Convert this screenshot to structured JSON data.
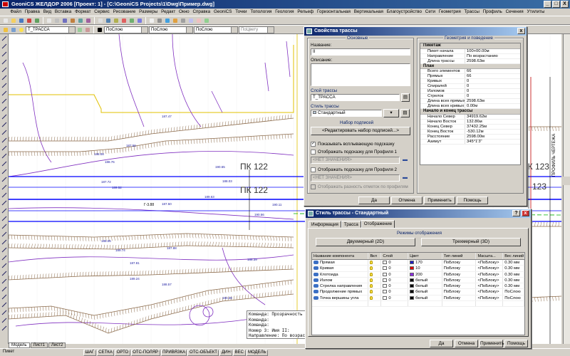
{
  "window": {
    "title": "GeoniCS ЖЕЛДОР 2006 [Проект: 1] - [C:\\GeoniCS Projects\\1\\Dwg\\Пример.dwg]",
    "buttons": [
      "_",
      "□",
      "X"
    ]
  },
  "menu": [
    "Файл",
    "Правка",
    "Вид",
    "Вставка",
    "Формат",
    "Сервис",
    "Рисование",
    "Размеры",
    "Редакт",
    "Окно",
    "Справка",
    "GeoniCS",
    "Точки",
    "Топология",
    "Геология",
    "Рельеф",
    "Горизонтальная",
    "Вертикальная",
    "Благоустройство",
    "Сети",
    "Геометрия",
    "Трассы",
    "Профиль",
    "Сечения",
    "Утилиты"
  ],
  "toolbar": {
    "layer_combo": "Т_ТРАССА",
    "color_combo": "ПоСлою",
    "linetype_combo": "ПоСлою",
    "lineweight_combo": "ПоСлою",
    "plotstyle_combo": "ПоЦвету"
  },
  "canvas": {
    "pk_labels": [
      "ПК 122",
      "ПК 122",
      "ПК 123",
      "123"
    ],
    "side_label": "ПРОФИЛЬ ЧЕРТЕЖА",
    "grade_label": "Г-3.88",
    "elevations": [
      "187.56",
      "188.08",
      "188.76",
      "190.65",
      "187.72",
      "189.52",
      "188.03",
      "189.63",
      "187.50",
      "188.06",
      "189.74",
      "187.81",
      "189.24",
      "188.57",
      "190.38",
      "187.88",
      "188.39",
      "190.56",
      "190.11",
      "187.47"
    ]
  },
  "command_line": [
    "Команда: Прозрачность объекта",
    "Команда:",
    "Команда:",
    "Номер 3: Имя II:",
    "Направление: По возрастанию"
  ],
  "model_tabs": [
    "Модель",
    "Лист1",
    "Лист2"
  ],
  "status": {
    "coords": "Пикет",
    "toggles": [
      "ШАГ",
      "СЕТКА",
      "ОРТО",
      "ОТС-ПОЛЯР",
      "ПРИВЯЗКА",
      "ОТС-ОБЪЕКТ",
      "ДИН",
      "ВЕС",
      "МОДЕЛЬ"
    ]
  },
  "props_dialog": {
    "title": "Свойства трассы",
    "left_group": "Основные",
    "name_label": "Название:",
    "name_value": "II",
    "desc_label": "Описание:",
    "layer_group": "Слой трассы",
    "layer_value": "Т_ТРАССА",
    "style_group": "Стиль трассы",
    "style_value": "Стандартный",
    "labels_group": "Набор подписей",
    "labels_button": "<Редактировать набор подписей...>",
    "chk_popup": "Показывать всплывающую подсказку",
    "chk_profile1": "Отображать подсказку для Профиля 1",
    "no_value_1": "<НЕТ ЗНАЧЕНИЯ>",
    "chk_profile2": "Отображать подсказку для Профиля 2",
    "no_value_2": "<НЕТ ЗНАЧЕНИЯ>",
    "chk_diff": "Отображать разность отметок по профилям",
    "right_group": "Геометрия и поведение",
    "sections": [
      {
        "title": "Пикетаж",
        "rows": [
          [
            "Пикет начала",
            "100+00.00м"
          ],
          [
            "Направление",
            "По возрастанию"
          ],
          [
            "Длина трассы",
            "2598.63м"
          ]
        ]
      },
      {
        "title": "План",
        "rows": [
          [
            "Всего элементов",
            "66"
          ],
          [
            "Прямых",
            "66"
          ],
          [
            "Кривых",
            "0"
          ],
          [
            "Спиралей",
            "0"
          ],
          [
            "Изломов",
            "0"
          ],
          [
            "Стрелок",
            "0"
          ],
          [
            "Длина всех прямых",
            "2598.63м"
          ],
          [
            "Длина всех кривых",
            "0.00м"
          ]
        ]
      },
      {
        "title": "Начало и конец трассы",
        "rows": [
          [
            "Начало Север",
            "34919.62м"
          ],
          [
            "Начало Восток",
            "132.86м"
          ],
          [
            "Конец Север",
            "37432.25м"
          ],
          [
            "Конец Восток",
            "-530.12м"
          ],
          [
            "Расстояние",
            "2598.00м"
          ],
          [
            "Азимут",
            "345°1'3\""
          ]
        ]
      }
    ],
    "buttons": {
      "ok": "Да",
      "cancel": "Отмена",
      "apply": "Применить",
      "help": "Помощь"
    }
  },
  "style_dialog": {
    "title": "Стиль трассы - Стандартный",
    "tabs": [
      "Информация",
      "Трасса",
      "Отображение"
    ],
    "active_tab": "Отображение",
    "modes_group": "Режимы отображения",
    "mode_2d": "Двухмерный (2D)",
    "mode_3d": "Трехмерный (3D)",
    "columns": [
      "Название компонента",
      "Вкл",
      "Слой",
      "Цвет",
      "Тип линий",
      "Масшта...",
      "Вес линий"
    ],
    "rows": [
      {
        "name": "Прямая",
        "layer": "0",
        "color": "170",
        "color_hex": "#1f1fbf",
        "linetype": "ПоБлоку",
        "scale": "<ПоБлоку>",
        "weight": "0.30 мм"
      },
      {
        "name": "Кривая",
        "layer": "0",
        "color": "10",
        "color_hex": "#e00000",
        "linetype": "ПоБлоку",
        "scale": "<ПоБлоку>",
        "weight": "0.30 мм"
      },
      {
        "name": "Клотоида",
        "layer": "0",
        "color": "200",
        "color_hex": "#8b2be2",
        "linetype": "ПоБлоку",
        "scale": "<ПоБлоку>",
        "weight": "0.30 мм"
      },
      {
        "name": "Излом",
        "layer": "0",
        "color": "белый",
        "color_hex": "#000000",
        "linetype": "ПоБлоку",
        "scale": "<ПоБлоку>",
        "weight": "0.30 мм"
      },
      {
        "name": "Стрелка направления",
        "layer": "0",
        "color": "белый",
        "color_hex": "#000000",
        "linetype": "ПоБлоку",
        "scale": "<ПоБлоку>",
        "weight": "0.30 мм"
      },
      {
        "name": "Продолжение прямых",
        "layer": "0",
        "color": "белый",
        "color_hex": "#000000",
        "linetype": "ПоБлоку",
        "scale": "<ПоБлоку>",
        "weight": "ПоСлою"
      },
      {
        "name": "Точка вершины угла",
        "layer": "0",
        "color": "белый",
        "color_hex": "#000000",
        "linetype": "ПоБлоку",
        "scale": "<ПоБлоку>",
        "weight": "ПоСлою"
      },
      {
        "name": "",
        "layer": "",
        "color": "",
        "color_hex": "",
        "linetype": "",
        "scale": "",
        "weight": ""
      }
    ],
    "buttons": {
      "ok": "Да",
      "cancel": "Отмена",
      "apply": "Применить",
      "help": "Помощь"
    }
  },
  "colors": {
    "accent": "#0a246a",
    "canvas_bg": "#ffffff",
    "track_blue": "#0000ff",
    "dialog_bg": "#d4d0c8"
  }
}
